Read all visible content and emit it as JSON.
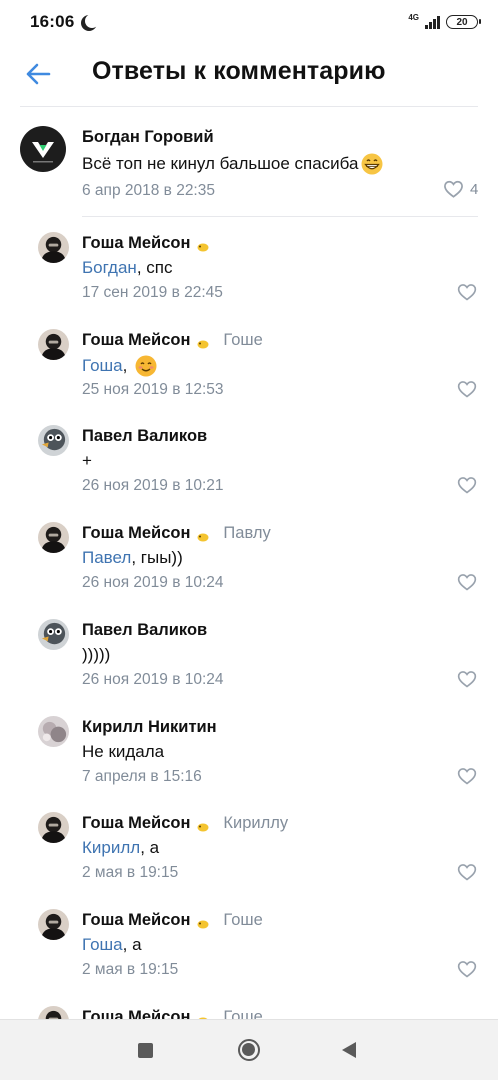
{
  "status_bar": {
    "time": "16:06",
    "network": "4G",
    "battery": "20"
  },
  "header": {
    "title": "Ответы к комментарию",
    "back_icon": "arrow-left-icon"
  },
  "colors": {
    "accent": "#3f74b1",
    "secondary_text": "#818c99",
    "divider": "#e7e8ec"
  },
  "main_comment": {
    "author": "Богдан Горовий",
    "text": "Всё топ не кинул бальшое спасиба",
    "emoji": "grinning-face-icon",
    "date": "6 апр 2018 в 22:35",
    "likes": "4"
  },
  "replies": [
    {
      "author": "Гоша Мейсон",
      "badge": true,
      "reply_to": "",
      "mention": "Богдан",
      "text": ", спс",
      "date": "17 сен 2019 в 22:45",
      "avatar": "gosha"
    },
    {
      "author": "Гоша Мейсон",
      "badge": true,
      "reply_to": "Гоше",
      "mention": "Гоша",
      "text": ", ",
      "emoji": "smiling-face-icon",
      "date": "25 ноя 2019 в 12:53",
      "avatar": "gosha"
    },
    {
      "author": "Павел Валиков",
      "badge": false,
      "reply_to": "",
      "mention": "",
      "text": "+",
      "date": "26 ноя 2019 в 10:21",
      "avatar": "pavel"
    },
    {
      "author": "Гоша Мейсон",
      "badge": true,
      "reply_to": "Павлу",
      "mention": "Павел",
      "text": ", гыы))",
      "date": "26 ноя 2019 в 10:24",
      "avatar": "gosha"
    },
    {
      "author": "Павел Валиков",
      "badge": false,
      "reply_to": "",
      "mention": "",
      "text": ")))))",
      "date": "26 ноя 2019 в 10:24",
      "avatar": "pavel"
    },
    {
      "author": "Кирилл Никитин",
      "badge": false,
      "reply_to": "",
      "mention": "",
      "text": "Не кидала",
      "date": "7 апреля в 15:16",
      "avatar": "kirill"
    },
    {
      "author": "Гоша Мейсон",
      "badge": true,
      "reply_to": "Кириллу",
      "mention": "Кирилл",
      "text": ", а",
      "date": "2 мая в 19:15",
      "avatar": "gosha"
    },
    {
      "author": "Гоша Мейсон",
      "badge": true,
      "reply_to": "Гоше",
      "mention": "Гоша",
      "text": ", а",
      "date": "2 мая в 19:15",
      "avatar": "gosha"
    },
    {
      "author": "Гоша Мейсон",
      "badge": true,
      "reply_to": "Гоше",
      "mention": "",
      "text": "",
      "date": "",
      "avatar": "gosha"
    }
  ],
  "nav_bar": {
    "recents_icon": "square-icon",
    "home_icon": "circle-icon",
    "back_icon": "triangle-back-icon"
  }
}
